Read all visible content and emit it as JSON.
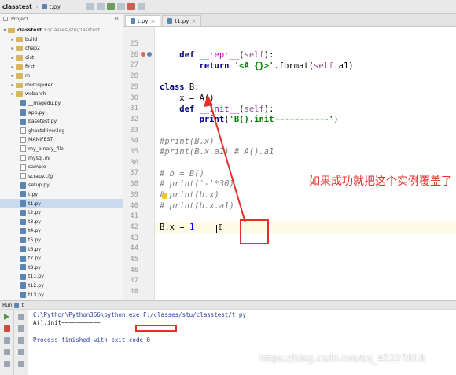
{
  "breadcrumb": {
    "root": "classtest",
    "file": "t.py"
  },
  "project": {
    "header_label": "Project",
    "root_name": "classtest",
    "root_path": "F:\\classes\\stu\\classtest",
    "items": [
      {
        "label": "build",
        "kind": "folder"
      },
      {
        "label": "chap2",
        "kind": "folder"
      },
      {
        "label": "dist",
        "kind": "folder"
      },
      {
        "label": "first",
        "kind": "folder"
      },
      {
        "label": "m",
        "kind": "folder"
      },
      {
        "label": "multispider",
        "kind": "folder"
      },
      {
        "label": "webarch",
        "kind": "folder"
      },
      {
        "label": "__magedu.py",
        "kind": "py"
      },
      {
        "label": "app.py",
        "kind": "py"
      },
      {
        "label": "basetest.py",
        "kind": "py"
      },
      {
        "label": "ghostdriver.log",
        "kind": "txt"
      },
      {
        "label": "MANIFEST",
        "kind": "txt"
      },
      {
        "label": "my_binary_file",
        "kind": "txt"
      },
      {
        "label": "mysql.ini",
        "kind": "txt"
      },
      {
        "label": "sample",
        "kind": "txt"
      },
      {
        "label": "scrapy.cfg",
        "kind": "txt"
      },
      {
        "label": "setup.py",
        "kind": "py"
      },
      {
        "label": "t.py",
        "kind": "py"
      },
      {
        "label": "t1.py",
        "kind": "py"
      },
      {
        "label": "t2.py",
        "kind": "py"
      },
      {
        "label": "t3.py",
        "kind": "py"
      },
      {
        "label": "t4.py",
        "kind": "py"
      },
      {
        "label": "t5.py",
        "kind": "py"
      },
      {
        "label": "t6.py",
        "kind": "py"
      },
      {
        "label": "t7.py",
        "kind": "py"
      },
      {
        "label": "t8.py",
        "kind": "py"
      },
      {
        "label": "t11.py",
        "kind": "py"
      },
      {
        "label": "t12.py",
        "kind": "py"
      },
      {
        "label": "t13.py",
        "kind": "py"
      }
    ],
    "selected_index": 18
  },
  "tabs": [
    {
      "label": "t.py",
      "active": true
    },
    {
      "label": "t1.py",
      "active": false
    }
  ],
  "editor": {
    "line_numbers": [
      "25",
      "26",
      "27",
      "28",
      "29",
      "30",
      "31",
      "32",
      "33",
      "34",
      "35",
      "36",
      "37",
      "38",
      "39",
      "40",
      "41",
      "42",
      "43",
      "44",
      "45",
      "46",
      "47",
      "48"
    ],
    "current_line": "42"
  },
  "annotation": {
    "text": "如果成功就把这个实例覆盖了",
    "color": "#e5302a"
  },
  "run": {
    "header_label": "Run",
    "config_name": "t",
    "command": "C:\\Python\\Python366\\python.exe F:/classes/stu/classtest/t.py",
    "output_line": "A().init~~~~~~~~~~~",
    "exit_line": "Process finished with exit code 0"
  },
  "watermark": "https://blog.csdn.net/qq_42227818"
}
